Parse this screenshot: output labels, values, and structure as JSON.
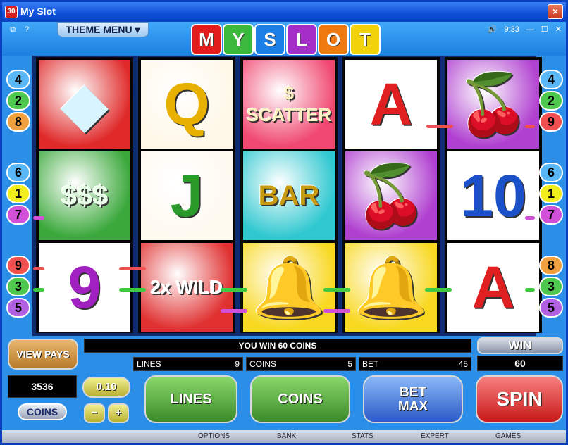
{
  "window": {
    "title": "My Slot",
    "app_icon": "slot-app-icon",
    "close": "×"
  },
  "topbar": {
    "help_icon_left": "⧉",
    "help_icon_q": "?",
    "theme_menu": "THEME MENU",
    "logo_letters": [
      "M",
      "Y",
      "S",
      "L",
      "O",
      "T"
    ],
    "logo_colors": [
      "#e21c1c",
      "#3cb83c",
      "#1c7fe8",
      "#a62ec8",
      "#f07a10",
      "#f2d20a"
    ],
    "time": "9:33"
  },
  "left_badges": [
    "4",
    "2",
    "8",
    "6",
    "1",
    "7",
    "9",
    "3",
    "5"
  ],
  "right_badges": [
    "4",
    "2",
    "9",
    "6",
    "1",
    "7",
    "8",
    "3",
    "5"
  ],
  "badge_colors": {
    "1": "#f2ee1e",
    "2": "#4fc84f",
    "3": "#4fc84f",
    "4": "#5ab8f8",
    "5": "#b060e0",
    "6": "#5ab8f8",
    "7": "#d050d8",
    "8": "#f0a040",
    "9": "#f05050"
  },
  "reels": [
    [
      {
        "label": "◆",
        "desc": "diamond",
        "bg": "#e02a2a",
        "fg": "#d8f4ff"
      },
      {
        "label": "$$$",
        "desc": "cash",
        "bg": "#3aa83a",
        "fg": "#e8ffe8"
      },
      {
        "label": "9",
        "desc": "nine",
        "bg": "#ffffff",
        "fg": "#a020c0"
      }
    ],
    [
      {
        "label": "Q",
        "desc": "queen",
        "bg": "#fff8e8",
        "fg": "#e8b000"
      },
      {
        "label": "J",
        "desc": "jack",
        "bg": "#fffaf0",
        "fg": "#2a9a2a"
      },
      {
        "label": "2x WILD",
        "desc": "wild",
        "bg": "#e03030",
        "fg": "#ffffff"
      }
    ],
    [
      {
        "label": "$ SCATTER",
        "desc": "scatter",
        "bg": "#f04870",
        "fg": "#fff0c0"
      },
      {
        "label": "BAR",
        "desc": "bar",
        "bg": "#30c8d0",
        "fg": "#c89a10"
      },
      {
        "label": "🔔",
        "desc": "bell",
        "bg": "#f8d820",
        "fg": "#c89010"
      }
    ],
    [
      {
        "label": "A",
        "desc": "ace",
        "bg": "#ffffff",
        "fg": "#e02020"
      },
      {
        "label": "🍒",
        "desc": "cherries",
        "bg": "#b040d0",
        "fg": "#e02020"
      },
      {
        "label": "🔔",
        "desc": "bell",
        "bg": "#f8d820",
        "fg": "#c89010"
      }
    ],
    [
      {
        "label": "🍒",
        "desc": "cherries",
        "bg": "#b040d0",
        "fg": "#e02020"
      },
      {
        "label": "10",
        "desc": "ten",
        "bg": "#ffffff",
        "fg": "#1a50c8"
      },
      {
        "label": "A",
        "desc": "ace",
        "bg": "#ffffff",
        "fg": "#e02020"
      }
    ]
  ],
  "status": {
    "message": "YOU WIN 60 COINS",
    "lines_label": "LINES",
    "lines_value": "9",
    "coins_label": "COINS",
    "coins_value": "5",
    "bet_label": "BET",
    "bet_value": "45",
    "win_label": "WIN",
    "win_value": "60"
  },
  "controls": {
    "view_pays": "VIEW PAYS",
    "balance": "3536",
    "coin_size": "0.10",
    "coins_toggle": "COINS",
    "minus": "−",
    "plus": "+",
    "lines": "LINES",
    "coins": "COINS",
    "bet_max": "BET MAX",
    "spin": "SPIN"
  },
  "footer": {
    "options": "OPTIONS",
    "bank": "BANK",
    "stats": "STATS",
    "expert": "EXPERT",
    "games": "GAMES"
  }
}
